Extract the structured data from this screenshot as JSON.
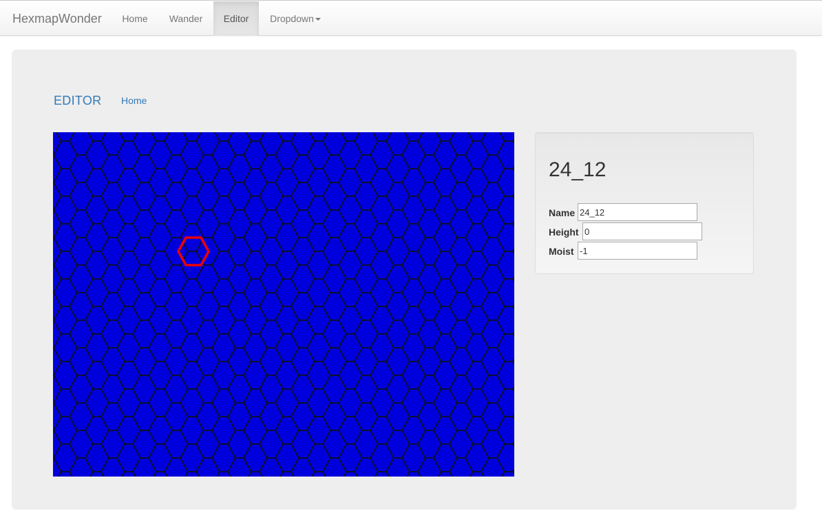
{
  "navbar": {
    "brand": "HexmapWonder",
    "items": [
      {
        "label": "Home",
        "active": false
      },
      {
        "label": "Wander",
        "active": false
      },
      {
        "label": "Editor",
        "active": true
      },
      {
        "label": "Dropdown",
        "active": false
      }
    ]
  },
  "subnav": {
    "title": "EDITOR",
    "home": "Home"
  },
  "map": {
    "colors": {
      "water": "#0000dd",
      "water_dark": "#0000c0",
      "land": "#77ee00",
      "rock": "#000000",
      "grid": "#111111",
      "selection": "#ee0000"
    },
    "selected_hex": "24_12"
  },
  "panel": {
    "title": "24_12",
    "fields": {
      "name": {
        "label": "Name",
        "value": "24_12"
      },
      "height": {
        "label": "Height",
        "value": "0"
      },
      "moist": {
        "label": "Moist",
        "value": "-1"
      }
    }
  }
}
